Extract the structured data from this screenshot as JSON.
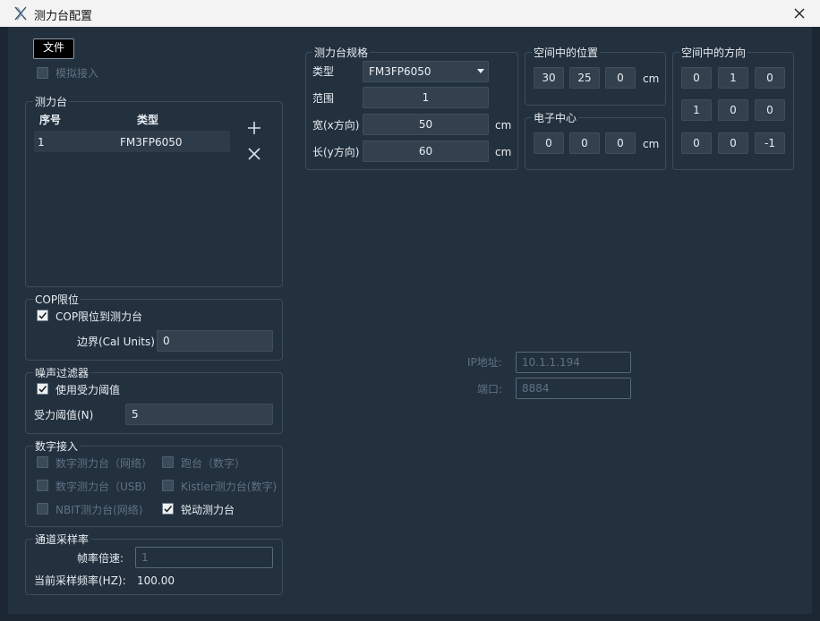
{
  "window": {
    "title": "测力台配置"
  },
  "file_button": "文件",
  "simulate_access": {
    "label": "模拟接入",
    "checked": false,
    "enabled": false
  },
  "platform_list": {
    "title": "测力台",
    "columns": [
      "序号",
      "类型"
    ],
    "rows": [
      {
        "index": "1",
        "type": "FM3FP6050"
      }
    ]
  },
  "cop": {
    "title": "COP限位",
    "limit_label": "COP限位到测力台",
    "limit_checked": true,
    "border_label": "边界(Cal Units)",
    "border_value": "0"
  },
  "noise": {
    "title": "噪声过滤器",
    "use_threshold_label": "使用受力阈值",
    "use_threshold_checked": true,
    "threshold_label": "受力阈值(N)",
    "threshold_value": "5"
  },
  "digital": {
    "title": "数字接入",
    "items": [
      {
        "label": "数字测力台（网络）",
        "checked": false,
        "enabled": false
      },
      {
        "label": "跑台（数字）",
        "checked": false,
        "enabled": false
      },
      {
        "label": "数字测力台（USB）",
        "checked": false,
        "enabled": false
      },
      {
        "label": "Kistler测力台(数字)",
        "checked": false,
        "enabled": false
      },
      {
        "label": "NBIT测力台(网络)",
        "checked": false,
        "enabled": false
      },
      {
        "label": "锐动测力台",
        "checked": true,
        "enabled": true
      }
    ]
  },
  "sampling": {
    "title": "通道采样率",
    "frame_multiplier_label": "帧率倍速:",
    "frame_multiplier_value": "1",
    "current_rate_label": "当前采样频率(HZ):",
    "current_rate_value": "100.00"
  },
  "spec": {
    "title": "测力台规格",
    "type_label": "类型",
    "type_value": "FM3FP6050",
    "range_label": "范围",
    "range_value": "1",
    "width_label": "宽(x方向)",
    "width_value": "50",
    "length_label": "长(y方向)",
    "length_value": "60",
    "unit": "cm"
  },
  "position": {
    "title": "空间中的位置",
    "values": [
      "30",
      "25",
      "0"
    ],
    "unit": "cm"
  },
  "electronic_center": {
    "title": "电子中心",
    "values": [
      "0",
      "0",
      "0"
    ],
    "unit": "cm"
  },
  "orientation": {
    "title": "空间中的方向",
    "values": [
      "0",
      "1",
      "0",
      "1",
      "0",
      "0",
      "0",
      "0",
      "-1"
    ]
  },
  "network": {
    "ip_label": "IP地址:",
    "ip_value": "10.1.1.194",
    "port_label": "端口:",
    "port_value": "8884"
  },
  "colors": {
    "background": "#23303d",
    "field": "#33404d",
    "disabled_text": "#5f7285",
    "titlebar": "#f3f3f3"
  }
}
